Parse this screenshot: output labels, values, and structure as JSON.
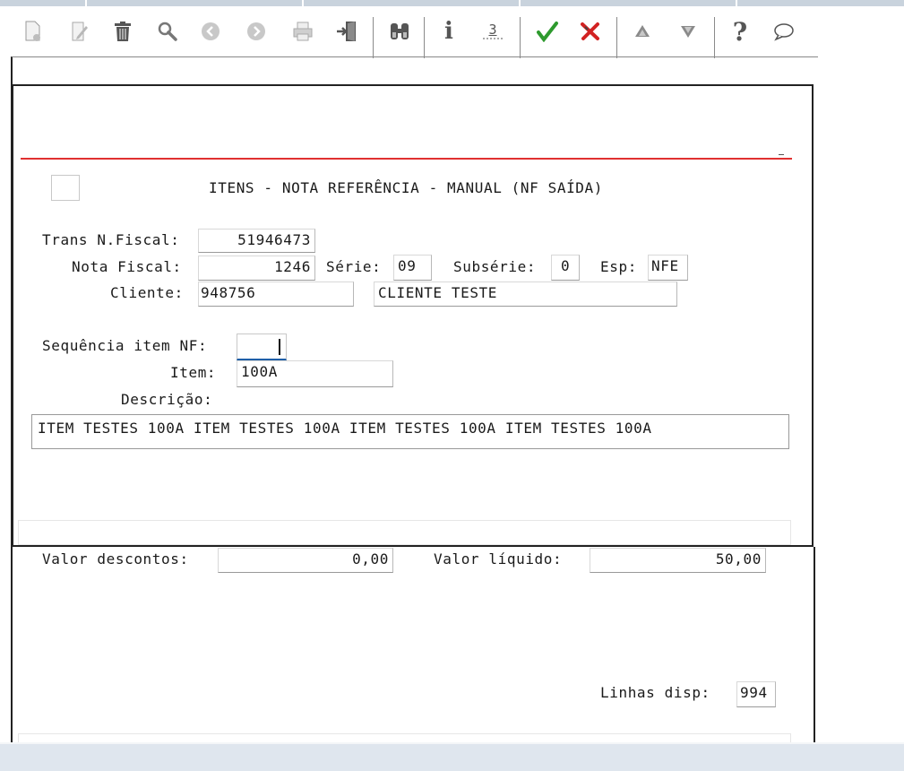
{
  "toolbar": {
    "icons": [
      "new-record-icon",
      "edit-icon",
      "delete-icon",
      "search-icon",
      "previous-icon",
      "next-icon",
      "print-icon",
      "exit-icon",
      "find-icon",
      "info-icon",
      "copy-icon",
      "confirm-icon",
      "cancel-icon",
      "up-icon",
      "down-icon",
      "help-icon",
      "chat-icon"
    ],
    "info_glyph": "i",
    "copy_glyph": "3",
    "help_glyph": "?",
    "colors": {
      "confirm": "#2e9a2e",
      "cancel": "#d22222",
      "icon_gray": "#6e6e6e"
    }
  },
  "dialog": {
    "title": "ITENS - NOTA REFERÊNCIA - MANUAL (NF SAÍDA)",
    "accent_line_color": "#e03030"
  },
  "form": {
    "trans_label": "Trans N.Fiscal:",
    "trans_value": "51946473",
    "nota_label": "Nota Fiscal:",
    "nota_value": "1246",
    "serie_label": "Série:",
    "serie_value": "09",
    "subserie_label": "Subsérie:",
    "subserie_value": "0",
    "esp_label": "Esp:",
    "esp_value": "NFE",
    "cliente_label": "Cliente:",
    "cliente_code": "948756",
    "cliente_name": "CLIENTE TESTE",
    "seq_label": "Sequência item NF:",
    "seq_value": "",
    "item_label": "Item:",
    "item_value": "100A",
    "desc_label": "Descrição:",
    "desc_value": "ITEM TESTES 100A ITEM TESTES 100A ITEM TESTES 100A ITEM TESTES 100A"
  },
  "totals": {
    "desc_label": "Valor descontos:",
    "desc_value": "0,00",
    "liq_label": "Valor líquido:",
    "liq_value": "50,00",
    "linhas_label": "Linhas disp:",
    "linhas_value": "994"
  }
}
